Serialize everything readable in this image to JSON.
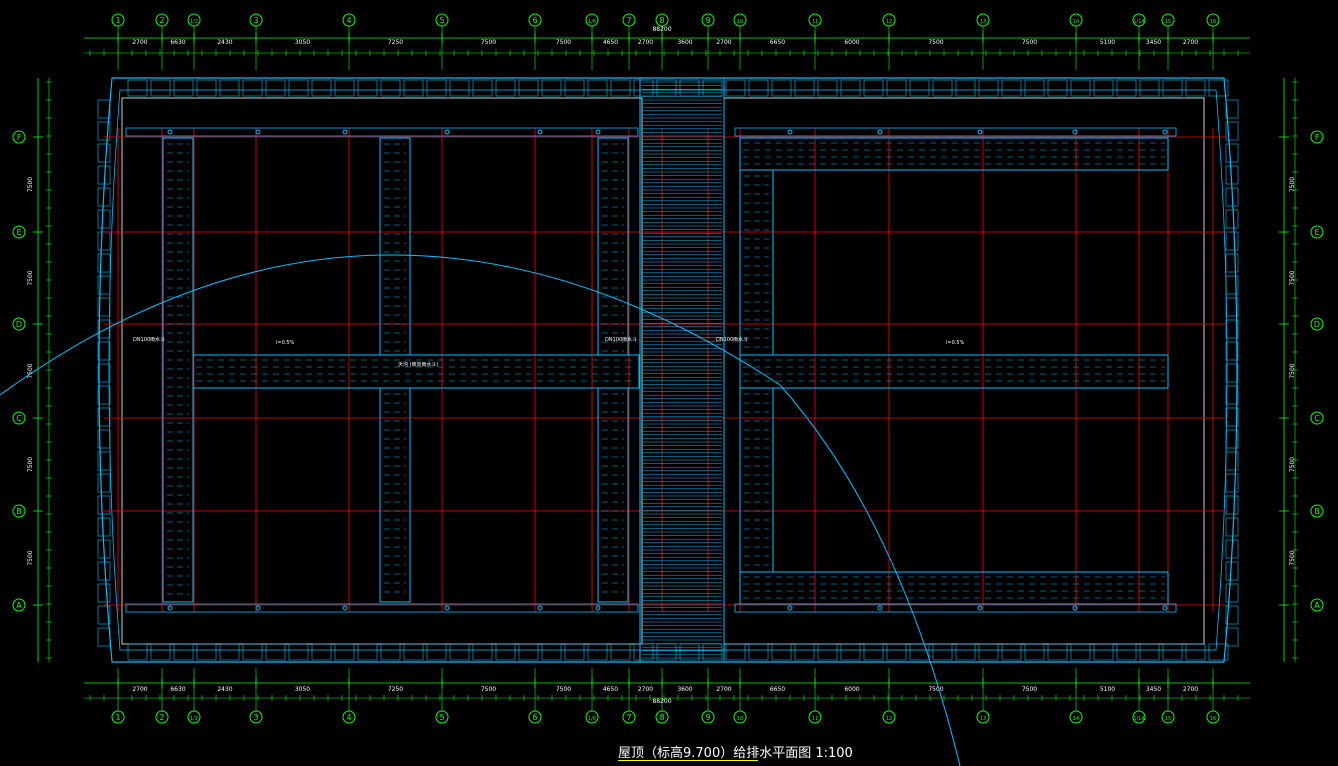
{
  "drawing": {
    "title": "屋顶（标高9.700）给排水平面图 1:100",
    "overall_dimension": "88200",
    "colors": {
      "background": "#000000",
      "grid_axis": "#ff0000",
      "building_outline": "#00bfff",
      "dimension": "#00ff00",
      "pipe": "#00bfff",
      "label": "#ffffff"
    },
    "column_axes": [
      "1",
      "2",
      "1/2",
      "3",
      "4",
      "5",
      "6",
      "1/6",
      "7",
      "8",
      "9",
      "10",
      "11",
      "12",
      "13",
      "14",
      "1/14",
      "15",
      "16"
    ],
    "row_axes_top_to_bottom": [
      "F",
      "E",
      "D",
      "C",
      "B",
      "A"
    ],
    "top_dimensions": [
      "2700",
      "6630",
      "2430",
      "3050",
      "7250",
      "7500",
      "7500",
      "4650",
      "2700",
      "3600",
      "2700",
      "6650",
      "6000",
      "7500",
      "7500",
      "5100",
      "3450",
      "2700"
    ],
    "bottom_dimensions": [
      "2700",
      "6630",
      "2430",
      "3050",
      "7250",
      "7500",
      "7500",
      "4650",
      "2700",
      "3600",
      "2700",
      "6650",
      "6000",
      "7500",
      "7500",
      "5100",
      "3450",
      "2700"
    ],
    "side_dimensions": [
      "7500",
      "7500",
      "7500",
      "7500",
      "7500"
    ],
    "notes": [
      "DN100雨水斗",
      "DN100雨水斗",
      "DN100雨水斗",
      "i=0.5%",
      "i=0.5%",
      "天沟 (坡向雨水斗)"
    ]
  }
}
